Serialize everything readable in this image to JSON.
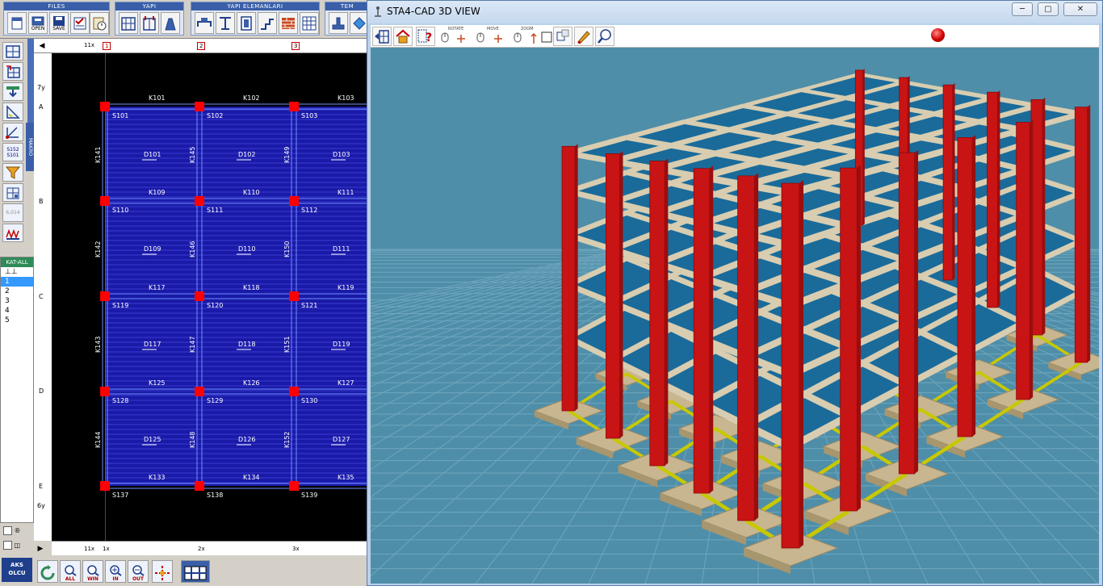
{
  "app": {
    "toolbar_groups": {
      "files": "FILES",
      "yapi": "YAPI",
      "yapi_elemanlari": "YAPI ELEMANLARI",
      "temel": "TEM"
    },
    "files_buttons": {
      "new": "",
      "open": "OPEN",
      "save": "SAVE"
    },
    "makro": "MAKRO",
    "left_tool_captions": {
      "slab": "S152",
      "slab2": "S101",
      "dim": "6,014"
    }
  },
  "floors": {
    "header": "KAT-ALL",
    "items": [
      "⊥⊥",
      "1",
      "2",
      "3",
      "4",
      "5"
    ],
    "selected": "1"
  },
  "aks_olcu": {
    "line1": "AKS",
    "line2": "OLCU"
  },
  "bottom_toolbar": {
    "all": "ALL",
    "win": "WIN",
    "in": "IN",
    "out": "OUT"
  },
  "plan": {
    "top_axes": [
      "1",
      "2",
      "3"
    ],
    "top_dims": [
      "11x"
    ],
    "bottom_dims": [
      "11x",
      "1x",
      "2x",
      "3x"
    ],
    "left_axes": [
      "A",
      "B",
      "C",
      "D",
      "E"
    ],
    "left_dims": [
      "7y",
      "6y"
    ],
    "beams_horizontal": [
      [
        "K101",
        "K102",
        "K103"
      ],
      [
        "K109",
        "K110",
        "K111"
      ],
      [
        "K117",
        "K118",
        "K119"
      ],
      [
        "K125",
        "K126",
        "K127"
      ],
      [
        "K133",
        "K134",
        "K135"
      ]
    ],
    "beams_vertical": [
      [
        "K141",
        "K145",
        "K149"
      ],
      [
        "K142",
        "K146",
        "K150"
      ],
      [
        "K143",
        "K147",
        "K151"
      ],
      [
        "K144",
        "K148",
        "K152"
      ]
    ],
    "columns": [
      [
        "S101",
        "S102",
        "S103"
      ],
      [
        "S110",
        "S111",
        "S112"
      ],
      [
        "S119",
        "S120",
        "S121"
      ],
      [
        "S128",
        "S129",
        "S130"
      ],
      [
        "S137",
        "S138",
        "S139"
      ]
    ],
    "slabs": [
      [
        "D101",
        "D102",
        "D103"
      ],
      [
        "D109",
        "D110",
        "D111"
      ],
      [
        "D117",
        "D118",
        "D119"
      ],
      [
        "D125",
        "D126",
        "D127"
      ]
    ],
    "colors": {
      "slab": "#1a1aa8",
      "column": "#ff0000",
      "beam_line": "#6f8fff",
      "background": "#000000"
    }
  },
  "view3d": {
    "title": "STA4-CAD  3D VIEW",
    "controls": {
      "rotate": "ROTATE",
      "move": "MOVE",
      "zoom": "ZOOM"
    },
    "colors": {
      "column": "#c81414",
      "beam": "#d8cdb0",
      "slab": "#1a6b9a",
      "foundation": "#c8b690",
      "tie_beam": "#c8c800",
      "ground": "#4f8ea8"
    }
  }
}
